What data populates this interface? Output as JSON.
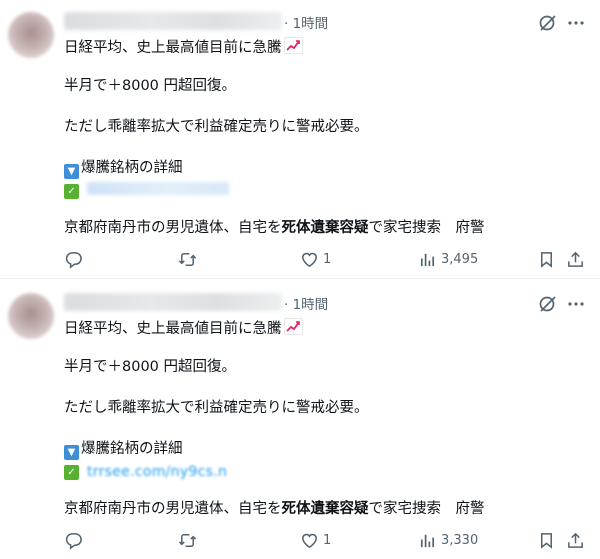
{
  "posts": [
    {
      "time": "· 1時間",
      "lines": [
        "日経平均、史上最高値目前に急騰",
        "半月で＋8000 円超回復。",
        "ただし乖離率拡大で利益確定売りに警戒必要。",
        "爆騰銘柄の詳細"
      ],
      "link": "",
      "headline_pre": "京都府南丹市の男児遺体、自宅を",
      "headline_bold": "死体遺棄容疑",
      "headline_post": "で家宅捜索　府警",
      "reply_count": "",
      "retweet_count": "",
      "like_count": "1",
      "view_count": "3,495"
    },
    {
      "time": "· 1時間",
      "lines": [
        "日経平均、史上最高値目前に急騰",
        "半月で＋8000 円超回復。",
        "ただし乖離率拡大で利益確定売りに警戒必要。",
        "爆騰銘柄の詳細"
      ],
      "link": "trrsee.com/ny9cs.n",
      "headline_pre": "京都府南丹市の男児遺体、自宅を",
      "headline_bold": "死体遺棄容疑",
      "headline_post": "で家宅捜索　府警",
      "reply_count": "",
      "retweet_count": "",
      "like_count": "1",
      "view_count": "3,330"
    }
  ],
  "icons": {
    "grok": "grok-icon",
    "more": "more-dots-icon",
    "reply": "reply-icon",
    "retweet": "retweet-icon",
    "like": "heart-icon",
    "views": "views-chart-icon",
    "bookmark": "bookmark-icon",
    "share": "share-icon",
    "chart_emoji": "chart-increasing-emoji",
    "down_button_emoji": "down-triangle-button-emoji",
    "check_emoji": "check-mark-button-emoji"
  },
  "colors": {
    "text": "#0f1419",
    "secondary": "#536471",
    "link": "#1d9bf0",
    "divider": "#eff3f4"
  }
}
